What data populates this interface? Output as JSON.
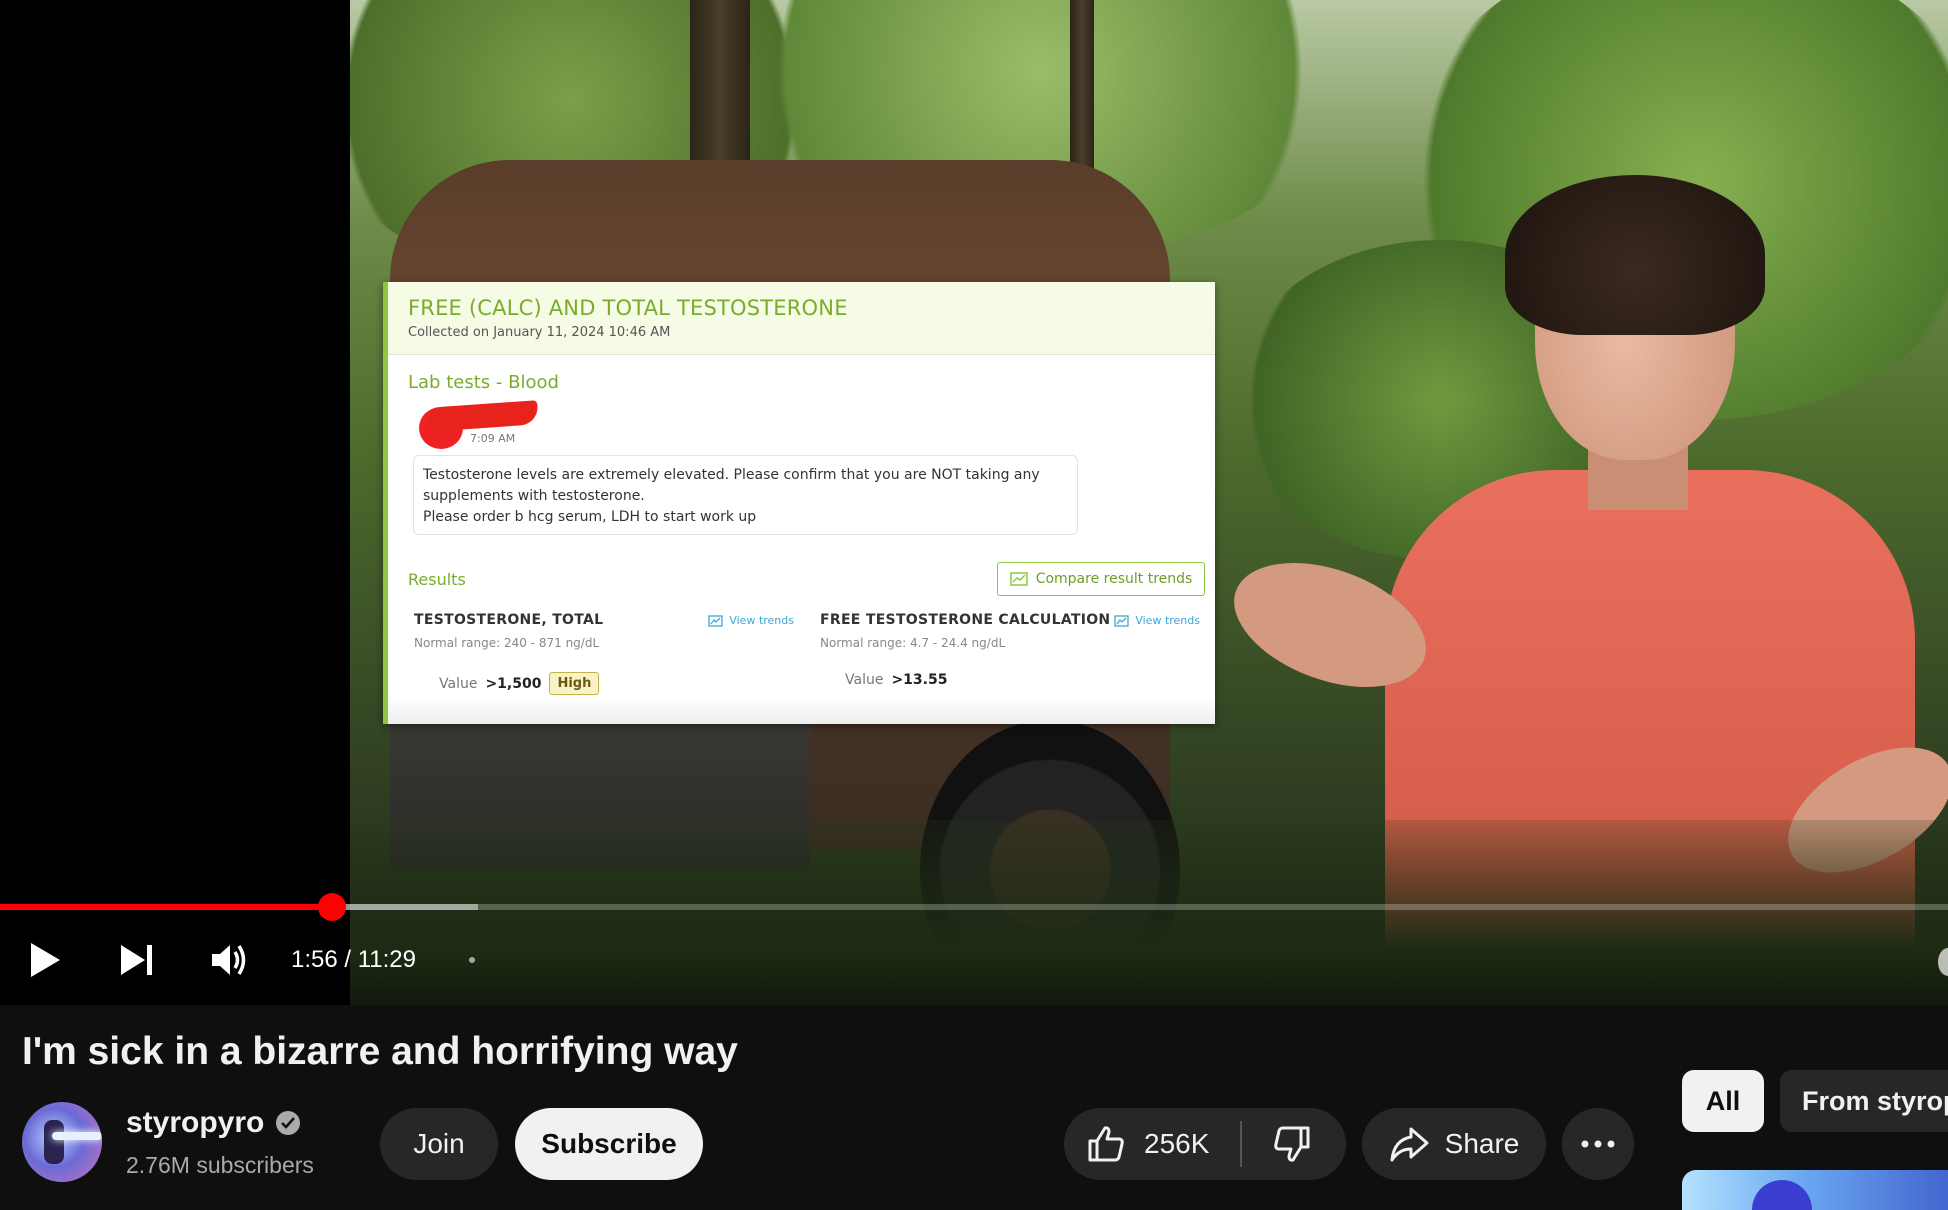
{
  "video": {
    "overlay": {
      "title": "FREE (CALC) AND TOTAL TESTOSTERONE",
      "collected": "Collected on January 11, 2024 10:46 AM",
      "section": "Lab tests - Blood",
      "note_time": "7:09 AM",
      "note_lines": [
        "Testosterone levels are extremely elevated. Please confirm that you are NOT taking any",
        "supplements with testosterone.",
        "Please order b hcg serum, LDH to start work up"
      ],
      "results_label": "Results",
      "compare_label": "Compare result trends",
      "results": [
        {
          "name": "TESTOSTERONE, TOTAL",
          "range": "Normal range: 240 - 871 ng/dL",
          "trends": "View trends",
          "value_label": "Value",
          "value": ">1,500",
          "flag": "High"
        },
        {
          "name": "FREE TESTOSTERONE CALCULATION",
          "range": "Normal range: 4.7 - 24.4 ng/dL",
          "trends": "View trends",
          "value_label": "Value",
          "value": ">13.55",
          "flag": ""
        }
      ],
      "colors": {
        "accent": "#7aac2c",
        "link": "#3ea7d8",
        "flag_bg": "#f8f2c7"
      }
    },
    "player": {
      "progress_fraction": 0.1702,
      "buffered_fraction": 0.2455,
      "current_time": "1:56",
      "duration": "11:29",
      "time_display": "1:56 / 11:29",
      "icons": [
        "play-icon",
        "next-icon",
        "volume-icon"
      ],
      "accent": "#ff0000"
    }
  },
  "title": "I'm sick in a bizarre and horrifying way",
  "channel": {
    "name": "styropyro",
    "subscribers": "2.76M subscribers",
    "verified_icon": "verified-check-icon"
  },
  "actions": {
    "join": "Join",
    "subscribe": "Subscribe",
    "likes": "256K",
    "share": "Share",
    "icons": [
      "thumbs-up-icon",
      "thumbs-down-icon",
      "share-arrow-icon",
      "more-horizontal-icon"
    ]
  },
  "chips": {
    "all": "All",
    "from": "From styropyro"
  }
}
